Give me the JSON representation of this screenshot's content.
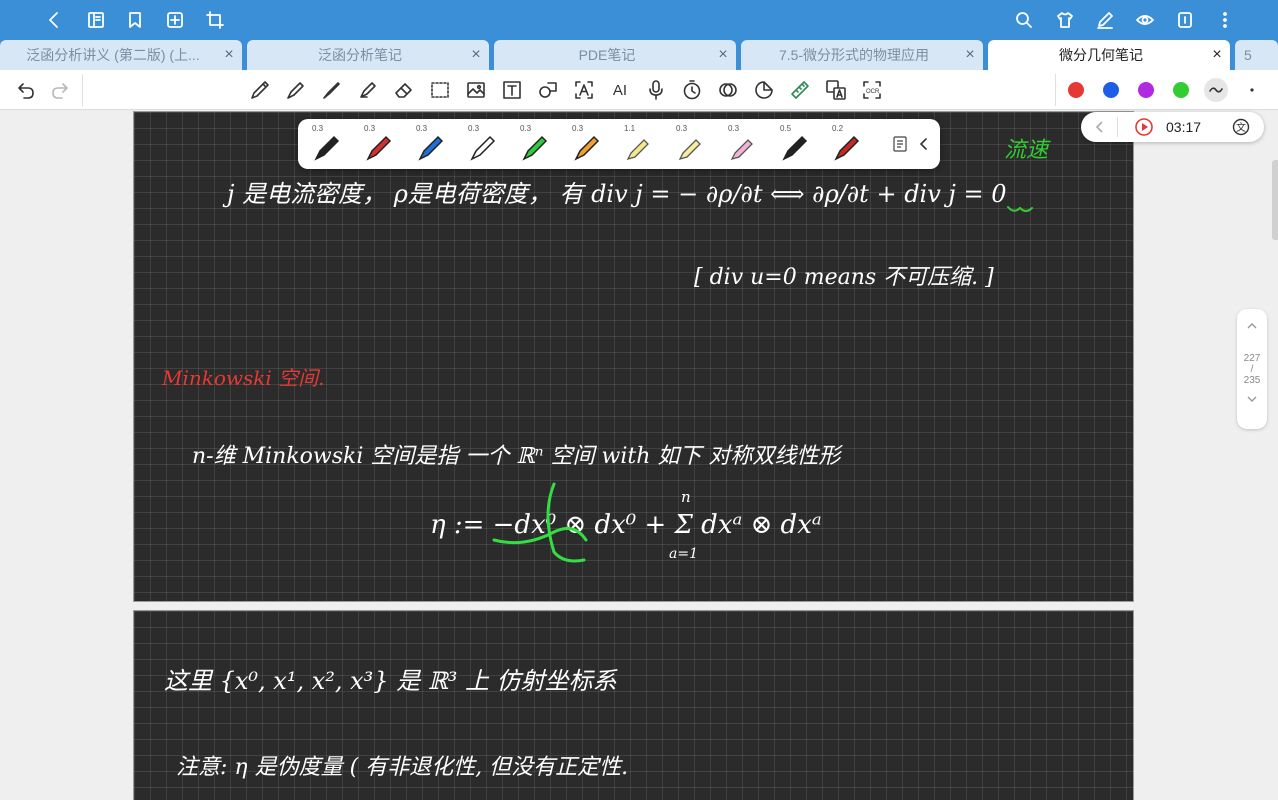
{
  "tabs": [
    {
      "label": "泛函分析讲义 (第二版) (上..."
    },
    {
      "label": "泛函分析笔记"
    },
    {
      "label": "PDE笔记"
    },
    {
      "label": "7.5-微分形式的物理应用"
    },
    {
      "label": "微分几何笔记"
    },
    {
      "label": "5"
    }
  ],
  "tab_close": "×",
  "pens": [
    {
      "size": "0.3",
      "color": "#222222"
    },
    {
      "size": "0.3",
      "color": "#d32f2f"
    },
    {
      "size": "0.3",
      "color": "#1e6fd9"
    },
    {
      "size": "0.3",
      "color": "#ffffff"
    },
    {
      "size": "0.3",
      "color": "#2ecc40"
    },
    {
      "size": "0.3",
      "color": "#f0a030"
    },
    {
      "size": "1.1",
      "color": "#f3e98a"
    },
    {
      "size": "0.3",
      "color": "#f5ee9a"
    },
    {
      "size": "0.3",
      "color": "#f2b3d8"
    },
    {
      "size": "0.5",
      "color": "#222222"
    },
    {
      "size": "0.2",
      "color": "#c62828"
    }
  ],
  "colors": [
    "#e53935",
    "#1e5ee6",
    "#b02ae0",
    "#33cc33"
  ],
  "audio": {
    "time": "03:17"
  },
  "page_nav": {
    "current": "227",
    "sep": "/",
    "total": "235"
  },
  "notes": {
    "line1": "j 是电流密度， ρ是电荷密度， 有  div j = − ∂ρ/∂t  ⟺  ∂ρ/∂t + div j = 0",
    "annot_green": "流速",
    "bracket": "[ div u=0  means  不可压缩. ]",
    "heading_red": "Minkowski 空间.",
    "line2": "n-维 Minkowski 空间是指 一个 ℝⁿ 空间 with 如下 对称双线性形",
    "formula": "η := −dx⁰ ⊗ dx⁰ + Σ dxᵃ ⊗ dxᵃ",
    "sum_top": "n",
    "sum_bottom": "a=1",
    "line3": "这里 {x⁰, x¹, x², x³} 是 ℝ³ 上 仿射坐标系",
    "line4": "注意: η 是伪度量 ( 有非退化性, 但没有正定性."
  }
}
